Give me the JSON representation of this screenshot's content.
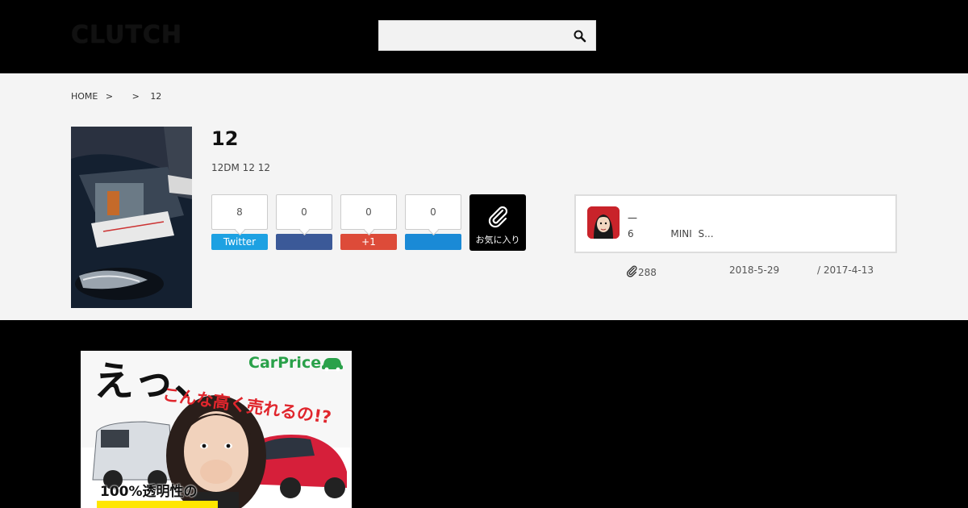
{
  "header": {
    "logo": "CLUTCH",
    "search_placeholder": ""
  },
  "breadcrumb": {
    "home": "HOME",
    "sep1": ">",
    "sep2": ">",
    "current": "12"
  },
  "article": {
    "title": "12",
    "subtitle": "12DM 12 12"
  },
  "share": {
    "twitter": {
      "count": "8",
      "label": "Twitter"
    },
    "facebook": {
      "count": "0",
      "label": ""
    },
    "gplus": {
      "count": "0",
      "label": "+1"
    },
    "hatena": {
      "count": "0",
      "label": ""
    },
    "favorite_label": "お気に入り"
  },
  "author": {
    "name": "—",
    "stats": "6            MINI  S..."
  },
  "meta": {
    "clip_count": "288",
    "updated": "2018-5-29",
    "published": "/ 2017-4-13"
  },
  "ad": {
    "brand": "CarPrice",
    "exclaim": "えっ、",
    "headline": "こんな高く売れるの!?",
    "tagline": "100%透明性の"
  },
  "colors": {
    "twitter": "#1da1e2",
    "facebook": "#3b5998",
    "gplus": "#dd4b39",
    "hatena": "#1a8ad6"
  }
}
